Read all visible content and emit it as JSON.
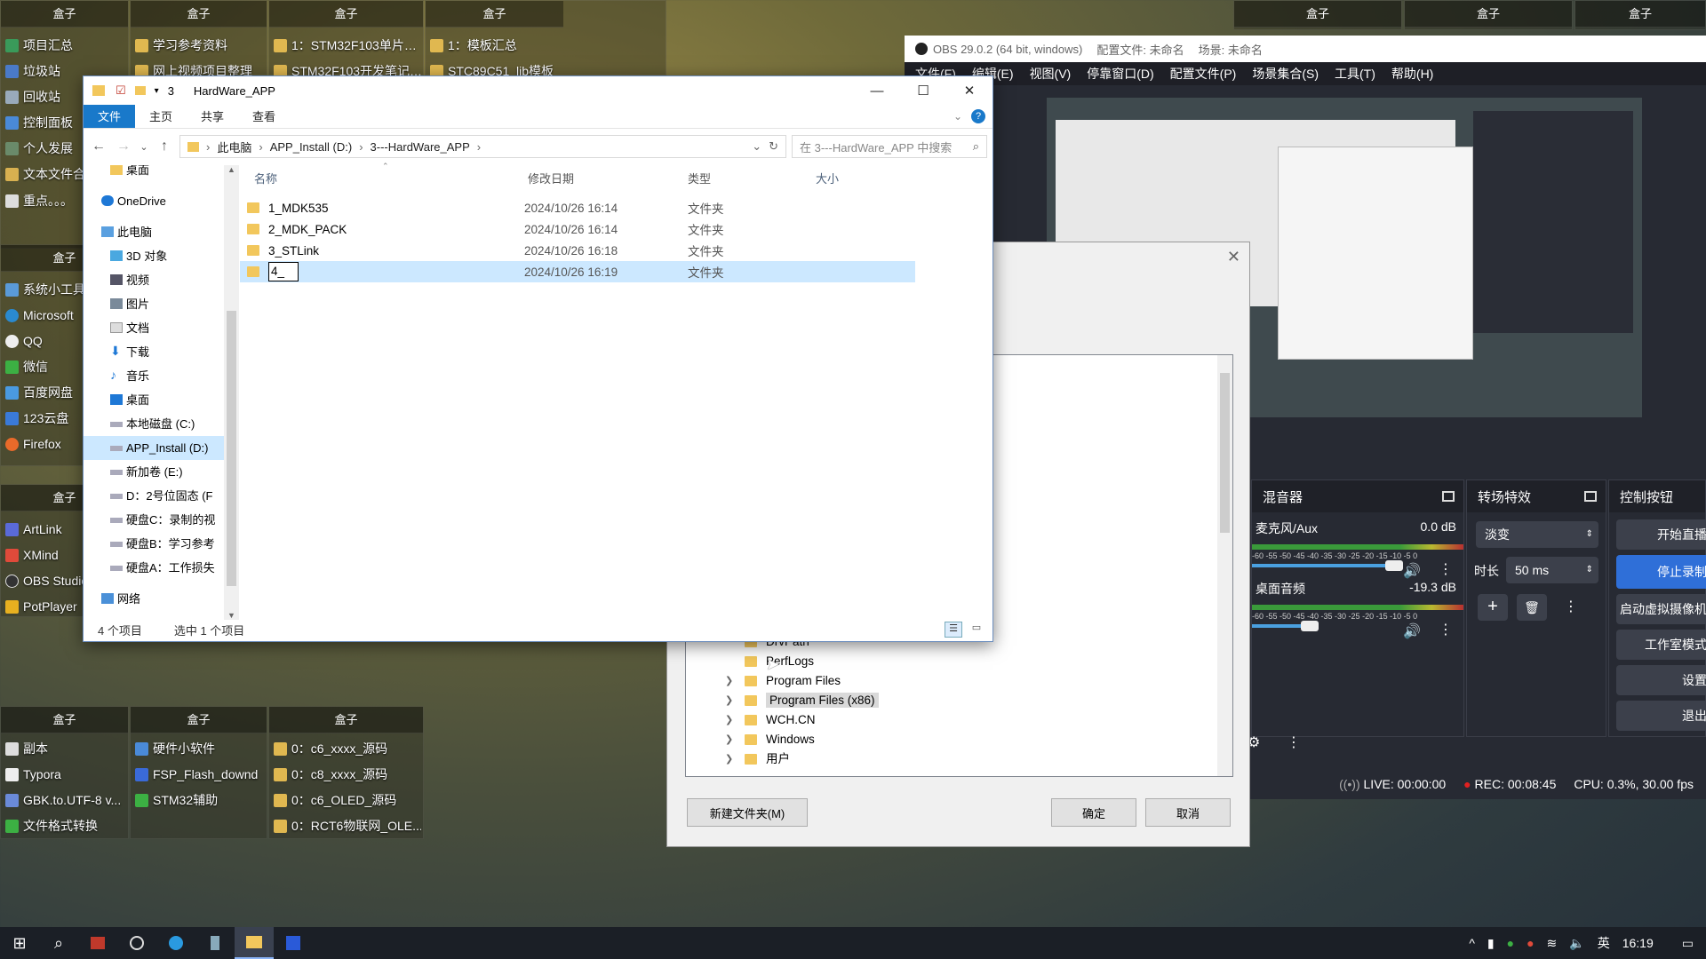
{
  "desktop": {
    "fences_top": [
      {
        "title": "盒子",
        "items": [
          "项目汇总",
          "垃圾站",
          "回收站",
          "控制面板",
          "个人发展",
          "文本文件合",
          "重点。。。"
        ]
      },
      {
        "title": "盒子",
        "items": [
          "学习参考资料",
          "网上视频项目整理"
        ]
      },
      {
        "title": "盒子",
        "items": [
          "1：STM32F103单片…",
          "STM32F103开发笔记…"
        ]
      },
      {
        "title": "盒子",
        "items": [
          "1：模板汇总",
          "STC89C51_lib模板"
        ]
      }
    ],
    "fence_mid_left": {
      "title": "盒子",
      "items": [
        "系统小工具",
        "Microsoft",
        "QQ",
        "微信",
        "百度网盘",
        "123云盘",
        "Firefox"
      ]
    },
    "fence_low_left": {
      "title": "盒子",
      "items": [
        "ArtLink",
        "XMind",
        "OBS Studio",
        "PotPlayer"
      ]
    },
    "fences_bottom": [
      {
        "title": "盒子",
        "items": [
          "副本",
          "Typora",
          "GBK.to.UTF-8 v...",
          "文件格式转换"
        ]
      },
      {
        "title": "盒子",
        "items": [
          "硬件小软件",
          "FSP_Flash_downd",
          "STM32辅助"
        ]
      },
      {
        "title": "盒子",
        "items": [
          "0：c6_xxxx_源码",
          "0：c8_xxxx_源码",
          "0：c6_OLED_源码",
          "0：RCT6物联网_OLE..."
        ]
      }
    ],
    "fences_right": [
      "盒子",
      "盒子",
      "盒子"
    ]
  },
  "explorer": {
    "title_num": "3",
    "title": "HardWare_APP",
    "ribbon_tabs": [
      "文件",
      "主页",
      "共享",
      "查看"
    ],
    "breadcrumb": [
      "此电脑",
      "APP_Install (D:)",
      "3---HardWare_APP"
    ],
    "search_placeholder": "在 3---HardWare_APP 中搜索",
    "nav_items": [
      {
        "label": "桌面",
        "icon": "desktop-icon"
      },
      {
        "label": "OneDrive",
        "icon": "cloud-icon"
      },
      {
        "label": "此电脑",
        "icon": "computer-icon"
      },
      {
        "label": "3D 对象",
        "icon": "cube-icon"
      },
      {
        "label": "视频",
        "icon": "video-icon"
      },
      {
        "label": "图片",
        "icon": "picture-icon"
      },
      {
        "label": "文档",
        "icon": "document-icon"
      },
      {
        "label": "下载",
        "icon": "download-icon"
      },
      {
        "label": "音乐",
        "icon": "music-icon"
      },
      {
        "label": "桌面",
        "icon": "desktop-icon"
      },
      {
        "label": "本地磁盘 (C:)",
        "icon": "drive-icon"
      },
      {
        "label": "APP_Install (D:)",
        "icon": "drive-icon",
        "selected": true
      },
      {
        "label": "新加卷 (E:)",
        "icon": "drive-icon"
      },
      {
        "label": "D：2号位固态 (F",
        "icon": "drive-icon"
      },
      {
        "label": "硬盘C：录制的视",
        "icon": "drive-icon"
      },
      {
        "label": "硬盘B：学习参考",
        "icon": "drive-icon"
      },
      {
        "label": "硬盘A：工作损失",
        "icon": "drive-icon"
      },
      {
        "label": "网络",
        "icon": "network-icon"
      }
    ],
    "columns": [
      "名称",
      "修改日期",
      "类型",
      "大小"
    ],
    "files": [
      {
        "name": "1_MDK535",
        "date": "2024/10/26 16:14",
        "type": "文件夹"
      },
      {
        "name": "2_MDK_PACK",
        "date": "2024/10/26 16:14",
        "type": "文件夹"
      },
      {
        "name": "3_STLink",
        "date": "2024/10/26 16:18",
        "type": "文件夹"
      },
      {
        "name": "4_",
        "date": "2024/10/26 16:19",
        "type": "文件夹",
        "selected": true,
        "renaming": true
      }
    ],
    "status_count": "4 个项目",
    "status_selected": "选中 1 个项目"
  },
  "dialog": {
    "tree": [
      {
        "label": "DrvPath",
        "expandable": false
      },
      {
        "label": "PerfLogs",
        "expandable": false
      },
      {
        "label": "Program Files",
        "expandable": true
      },
      {
        "label": "Program Files (x86)",
        "expandable": true,
        "selected": true
      },
      {
        "label": "WCH.CN",
        "expandable": true
      },
      {
        "label": "Windows",
        "expandable": true
      },
      {
        "label": "用户",
        "expandable": true
      }
    ],
    "new_folder": "新建文件夹(M)",
    "ok": "确定",
    "cancel": "取消"
  },
  "obs": {
    "title": "OBS 29.0.2 (64 bit, windows)",
    "profile": "配置文件: 未命名",
    "scene": "场景: 未命名",
    "menu": [
      "文件(F)",
      "编辑(E)",
      "视图(V)",
      "停靠窗口(D)",
      "配置文件(P)",
      "场景集合(S)",
      "工具(T)",
      "帮助(H)"
    ],
    "mixer": {
      "title": "混音器",
      "tracks": [
        {
          "name": "麦克风/Aux",
          "db": "0.0 dB",
          "level": 0.82
        },
        {
          "name": "桌面音频",
          "db": "-19.3 dB",
          "level": 0.6
        }
      ],
      "scale": "-60 -55 -50 -45 -40 -35 -30 -25 -20 -15 -10 -5 0"
    },
    "transitions": {
      "title": "转场特效",
      "type": "淡变",
      "duration_label": "时长",
      "duration": "50 ms"
    },
    "controls": {
      "title": "控制按钮",
      "buttons": [
        "开始直播",
        "停止录制",
        "启动虚拟摄像机",
        "工作室模式",
        "设置",
        "退出"
      ]
    },
    "status": {
      "live": "LIVE: 00:00:00",
      "rec": "REC: 00:08:45",
      "cpu": "CPU: 0.3%, 30.00 fps"
    }
  },
  "taskbar": {
    "time": "16:19",
    "lang": "英"
  }
}
